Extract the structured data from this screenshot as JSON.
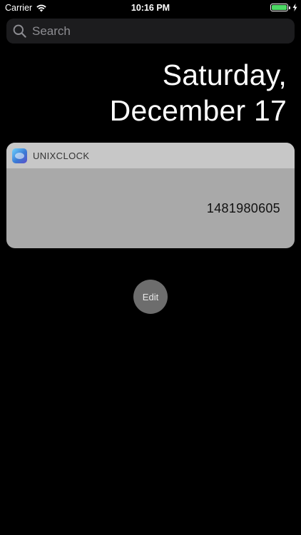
{
  "status_bar": {
    "carrier": "Carrier",
    "time": "10:16 PM"
  },
  "search": {
    "placeholder": "Search"
  },
  "date": {
    "weekday": "Saturday,",
    "month_day": "December 17"
  },
  "widget": {
    "app_name": "UNIXCLOCK",
    "timestamp": "1481980605"
  },
  "edit": {
    "label": "Edit"
  },
  "colors": {
    "background": "#000000",
    "battery": "#4cd964",
    "widget_body": "#a9a9a9",
    "widget_header": "#c7c7c7"
  },
  "icons": [
    "wifi-icon",
    "battery-icon",
    "charging-bolt-icon",
    "search-icon",
    "app-icon"
  ]
}
